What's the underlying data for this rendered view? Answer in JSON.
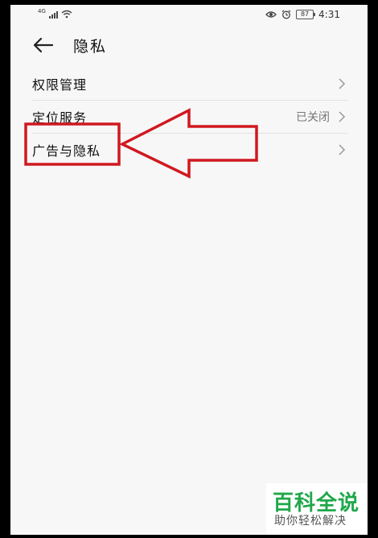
{
  "statusbar": {
    "network_tag": "4G",
    "battery": "87",
    "time": "4:31",
    "icons": [
      "signal-icon",
      "wifi-icon",
      "eye-icon",
      "alarm-icon",
      "battery-icon"
    ]
  },
  "header": {
    "title": "隐私",
    "back_icon": "arrow-left-icon"
  },
  "list": {
    "items": [
      {
        "label": "权限管理",
        "value": ""
      },
      {
        "label": "定位服务",
        "value": "已关闭"
      },
      {
        "label": "广告与隐私",
        "value": ""
      }
    ]
  },
  "annotation": {
    "color": "#d0191f",
    "shape": "arrow-pointing-left-with-highlight-box"
  },
  "watermark": {
    "title": "百科全说",
    "subtitle": "助你轻松解决",
    "color": "#1fa84a"
  }
}
